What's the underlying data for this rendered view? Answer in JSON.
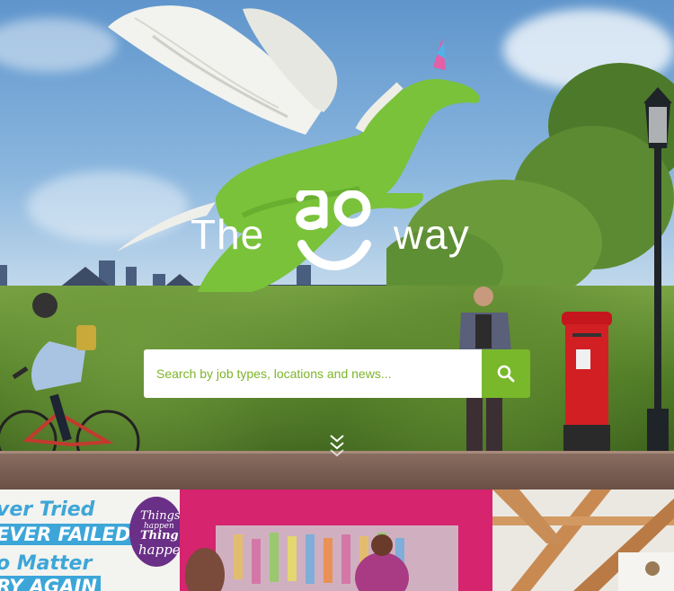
{
  "logo": {
    "word_before": "The",
    "mark": "ao",
    "word_after": "way"
  },
  "search": {
    "placeholder": "Search by job types, locations and news..."
  },
  "icons": {
    "search": "search-icon",
    "scroll": "chevron-double-down-icon"
  },
  "tiles": {
    "poster": {
      "lines": [
        "ver Tried",
        "EVER FAILED",
        "o Matter",
        "RY AGAIN"
      ]
    },
    "circle": {
      "lines": [
        "Things",
        "happen",
        "Thing",
        "happe"
      ]
    }
  },
  "colors": {
    "brand_green": "#78b82a",
    "white": "#ffffff",
    "poster_blue": "#3da6d8",
    "magenta": "#d6246f"
  }
}
